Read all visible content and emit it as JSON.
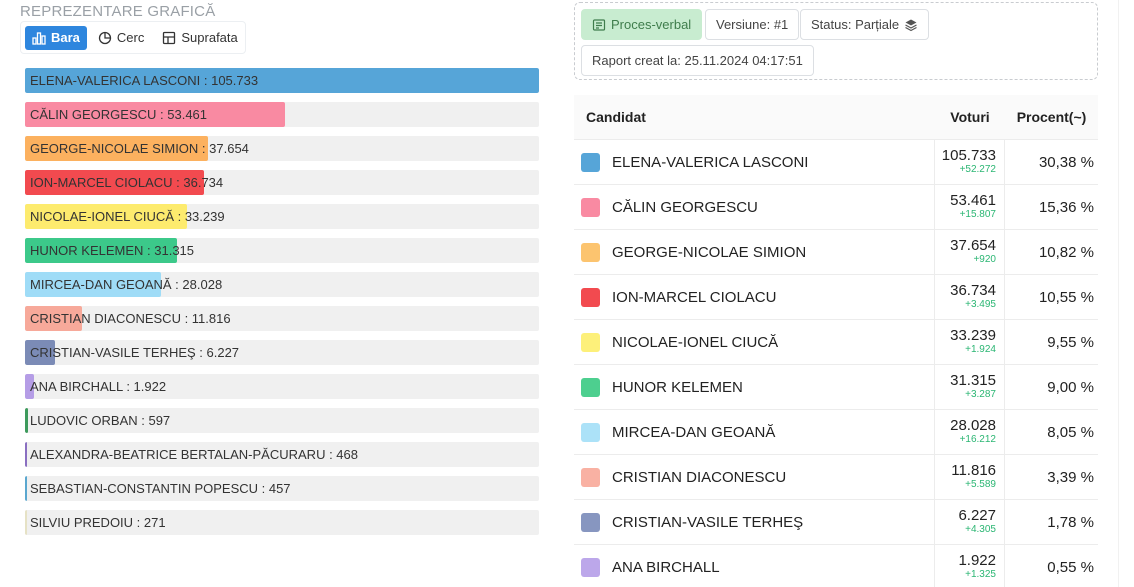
{
  "left": {
    "title": "REPREZENTARE GRAFICĂ",
    "views": [
      {
        "label": "Bara",
        "icon": "bar-chart-icon",
        "active": true
      },
      {
        "label": "Cerc",
        "icon": "pie-chart-icon",
        "active": false
      },
      {
        "label": "Suprafata",
        "icon": "area-chart-icon",
        "active": false
      }
    ]
  },
  "chart_data": {
    "type": "bar",
    "categories": [
      "ELENA-VALERICA LASCONI",
      "CĂLIN GEORGESCU",
      "GEORGE-NICOLAE SIMION",
      "ION-MARCEL CIOLACU",
      "NICOLAE-IONEL CIUCĂ",
      "HUNOR KELEMEN",
      "MIRCEA-DAN GEOANĂ",
      "CRISTIAN DIACONESCU",
      "CRISTIAN-VASILE TERHEŞ",
      "ANA BIRCHALL",
      "LUDOVIC ORBAN",
      "ALEXANDRA-BEATRICE BERTALAN-PĂCURARU",
      "SEBASTIAN-CONSTANTIN POPESCU",
      "SILVIU PREDOIU"
    ],
    "values": [
      105733,
      53461,
      37654,
      36734,
      33239,
      31315,
      28028,
      11816,
      6227,
      1922,
      597,
      468,
      457,
      271
    ],
    "labels": [
      "ELENA-VALERICA LASCONI : 105.733",
      "CĂLIN GEORGESCU : 53.461",
      "GEORGE-NICOLAE SIMION : 37.654",
      "ION-MARCEL CIOLACU : 36.734",
      "NICOLAE-IONEL CIUCĂ : 33.239",
      "HUNOR KELEMEN : 31.315",
      "MIRCEA-DAN GEOANĂ : 28.028",
      "CRISTIAN DIACONESCU : 11.816",
      "CRISTIAN-VASILE TERHEŞ : 6.227",
      "ANA BIRCHALL : 1.922",
      "LUDOVIC ORBAN : 597",
      "ALEXANDRA-BEATRICE BERTALAN-PĂCURARU : 468",
      "SEBASTIAN-CONSTANTIN POPESCU : 457",
      "SILVIU PREDOIU : 271"
    ],
    "colors": [
      "#56a5d8",
      "#f98aa2",
      "#fcb15f",
      "#f24a4f",
      "#fdeb6e",
      "#3cc98a",
      "#9fdcf7",
      "#f7a99a",
      "#7b8bb6",
      "#b59de6",
      "#3d9a5c",
      "#8a6fc1",
      "#5aa7cf",
      "#e6e2c5"
    ],
    "xlim": [
      0,
      105733
    ]
  },
  "right": {
    "chips": {
      "proces": "Proces-verbal",
      "versiune": "Versiune: #1",
      "status": "Status: Parțiale",
      "raport": "Raport creat la: 25.11.2024 04:17:51"
    },
    "table": {
      "headers": {
        "candidat": "Candidat",
        "voturi": "Voturi",
        "procent": "Procent(~)"
      },
      "rows": [
        {
          "name": "ELENA-VALERICA LASCONI",
          "votes": "105.733",
          "delta": "+52.272",
          "percent": "30,38 %",
          "color": "#56a5d8"
        },
        {
          "name": "CĂLIN GEORGESCU",
          "votes": "53.461",
          "delta": "+15.807",
          "percent": "15,36 %",
          "color": "#f98aa2"
        },
        {
          "name": "GEORGE-NICOLAE SIMION",
          "votes": "37.654",
          "delta": "+920",
          "percent": "10,82 %",
          "color": "#fcc46f"
        },
        {
          "name": "ION-MARCEL CIOLACU",
          "votes": "36.734",
          "delta": "+3.495",
          "percent": "10,55 %",
          "color": "#f24a4f"
        },
        {
          "name": "NICOLAE-IONEL CIUCĂ",
          "votes": "33.239",
          "delta": "+1.924",
          "percent": "9,55 %",
          "color": "#fdf07a"
        },
        {
          "name": "HUNOR KELEMEN",
          "votes": "31.315",
          "delta": "+3.287",
          "percent": "9,00 %",
          "color": "#4dcf8f"
        },
        {
          "name": "MIRCEA-DAN GEOANĂ",
          "votes": "28.028",
          "delta": "+16.212",
          "percent": "8,05 %",
          "color": "#ace2f8"
        },
        {
          "name": "CRISTIAN DIACONESCU",
          "votes": "11.816",
          "delta": "+5.589",
          "percent": "3,39 %",
          "color": "#f9b1a3"
        },
        {
          "name": "CRISTIAN-VASILE TERHEŞ",
          "votes": "6.227",
          "delta": "+4.305",
          "percent": "1,78 %",
          "color": "#8796c0"
        },
        {
          "name": "ANA BIRCHALL",
          "votes": "1.922",
          "delta": "+1.325",
          "percent": "0,55 %",
          "color": "#bca7ea"
        }
      ]
    }
  }
}
